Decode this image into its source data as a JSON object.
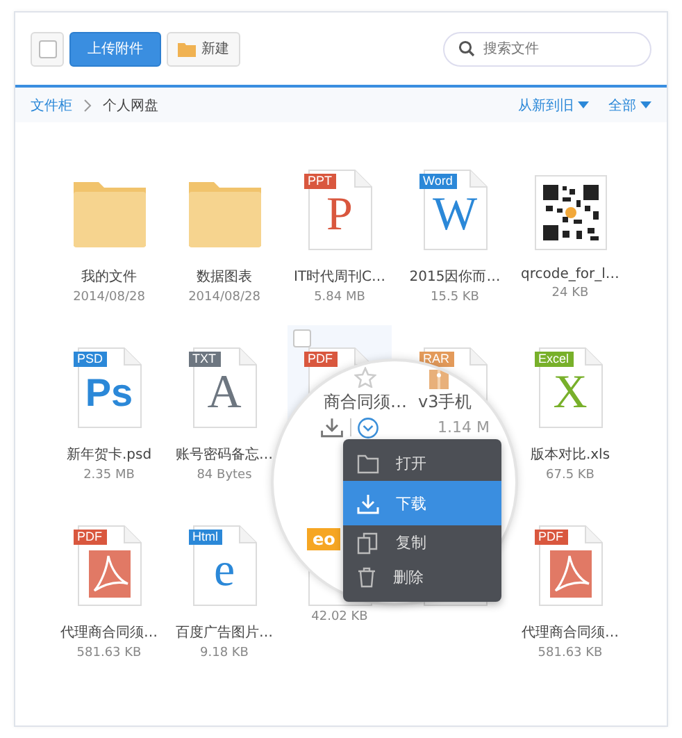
{
  "toolbar": {
    "select_all": {
      "checked": false
    },
    "upload_button": "上传附件",
    "new_button": "新建",
    "search": {
      "placeholder": "搜索文件"
    }
  },
  "breadcrumb": [
    "文件柜",
    "个人网盘"
  ],
  "sort": "从新到旧",
  "filter": "全部",
  "files": [
    {
      "kind": "folder",
      "highlighted": false,
      "name": "我的文件",
      "meta": "2014/08/28"
    },
    {
      "kind": "folder",
      "highlighted": false,
      "name": "数据图表",
      "meta": "2014/08/28"
    },
    {
      "kind": "letter",
      "highlighted": false,
      "tag": "PPT",
      "color": "#d9573e",
      "glyph": "P",
      "name": "IT时代周刊C…",
      "meta": "5.84 MB"
    },
    {
      "kind": "letter",
      "highlighted": false,
      "tag": "Word",
      "color": "#2b88d8",
      "glyph": "W",
      "name": "2015因你而…",
      "meta": "15.5 KB"
    },
    {
      "kind": "qr",
      "highlighted": false,
      "name": "qrcode_for_l…",
      "meta": "24 KB"
    },
    {
      "kind": "letter",
      "highlighted": false,
      "tag": "PSD",
      "color": "#2b88d8",
      "glyph": "Ps",
      "name": "新年贺卡.psd",
      "meta": "2.35 MB"
    },
    {
      "kind": "letter",
      "highlighted": false,
      "tag": "TXT",
      "color": "#6d7680",
      "glyph": "A",
      "name": "账号密码备忘…",
      "meta": "84 Bytes"
    },
    {
      "kind": "blank",
      "highlighted": true,
      "tag": "PDF",
      "color": "#d9573e"
    },
    {
      "kind": "blank",
      "highlighted": false,
      "tag": "RAR",
      "color": "#e39a5a"
    },
    {
      "kind": "letter",
      "highlighted": false,
      "tag": "Excel",
      "color": "#78b02a",
      "glyph": "X",
      "name": "版本对比.xls",
      "meta": "67.5 KB"
    },
    {
      "kind": "acrobat",
      "highlighted": false,
      "tag": "PDF",
      "color": "#d9573e",
      "name": "代理商合同须…",
      "meta": "581.63 KB"
    },
    {
      "kind": "letter",
      "highlighted": false,
      "tag": "Html",
      "color": "#2b88d8",
      "glyph": "e",
      "name": "百度广告图片…",
      "meta": "9.18 KB"
    },
    {
      "kind": "blank",
      "highlighted": false,
      "meta": "42.02 KB"
    },
    {
      "kind": "blank",
      "highlighted": false
    },
    {
      "kind": "acrobat",
      "highlighted": false,
      "tag": "PDF",
      "color": "#d9573e",
      "name": "代理商合同须…",
      "meta": "581.63 KB"
    }
  ],
  "magnifier": {
    "names": [
      "商合同须…",
      "v3手机"
    ],
    "size": "1.14 M",
    "video_tag": "eo"
  },
  "menu": [
    {
      "kind": "open",
      "label": "打开",
      "selected": false
    },
    {
      "kind": "download",
      "label": "下载",
      "selected": true
    },
    {
      "kind": "copy",
      "label": "复制",
      "selected": false
    },
    {
      "kind": "delete",
      "label": "删除",
      "selected": false
    }
  ]
}
